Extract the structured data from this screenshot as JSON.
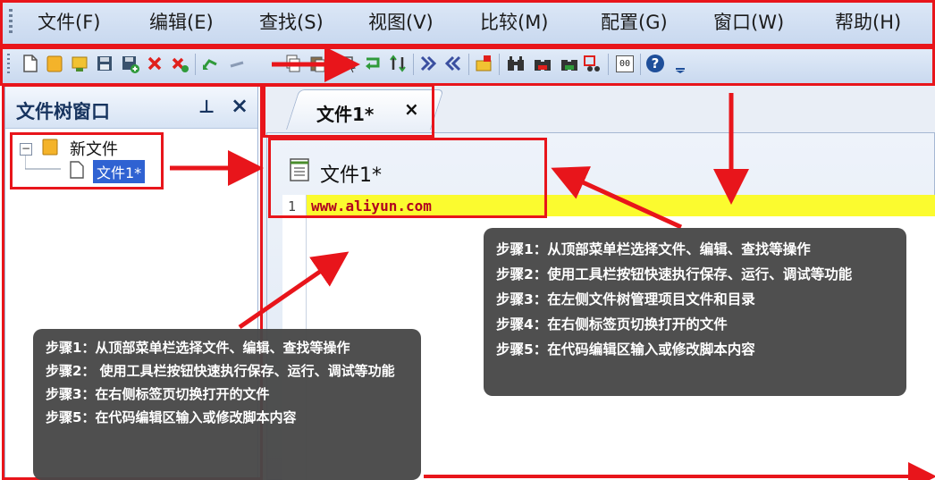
{
  "menu": {
    "items": [
      "文件(F)",
      "编辑(E)",
      "查找(S)",
      "视图(V)",
      "比较(M)",
      "配置(G)",
      "窗口(W)",
      "帮助(H)"
    ]
  },
  "toolbar": {
    "icons": [
      "new-file-icon",
      "open-folder-icon",
      "open-project-icon",
      "save-icon",
      "save-all-icon",
      "close-icon",
      "close-all-icon",
      "undo-icon",
      "redo-icon",
      "copy-icon",
      "paste-icon",
      "select-icon",
      "wrap-icon",
      "sort-icon",
      "indent-icon",
      "outdent-icon",
      "bookmark-icon",
      "find-icon",
      "find-next-icon",
      "find-prev-icon",
      "replace-icon",
      "hex-icon",
      "help-icon",
      "overflow-icon"
    ],
    "hex_label": "00",
    "help_label": "?"
  },
  "tree": {
    "title": "文件树窗口",
    "pin": "⊥",
    "close": "×",
    "expander": "−",
    "folder": "新文件",
    "file": "文件1*"
  },
  "editor": {
    "tab_label": "文件1*",
    "tab_close": "×",
    "doc_title": "文件1*",
    "line_number": "1",
    "code_line": "www.aliyun.com"
  },
  "notes": {
    "right": [
      "步骤1：从顶部菜单栏选择文件、编辑、查找等操作",
      "步骤2：使用工具栏按钮快速执行保存、运行、调试等功能",
      "步骤3：在左侧文件树管理项目文件和目录",
      "步骤4：在右侧标签页切换打开的文件",
      "步骤5：在代码编辑区输入或修改脚本内容"
    ],
    "left": [
      "步骤1：从顶部菜单栏选择文件、编辑、查找等操作",
      "步骤2： 使用工具栏按钮快速执行保存、运行、调试等功能",
      "步骤3：在右侧标签页切换打开的文件",
      "步骤5：在代码编辑区输入或修改脚本内容"
    ]
  },
  "colors": {
    "annotation_red": "#e8151b",
    "highlight_yellow": "#fbfb2f",
    "selection_blue": "#2f62d2"
  }
}
